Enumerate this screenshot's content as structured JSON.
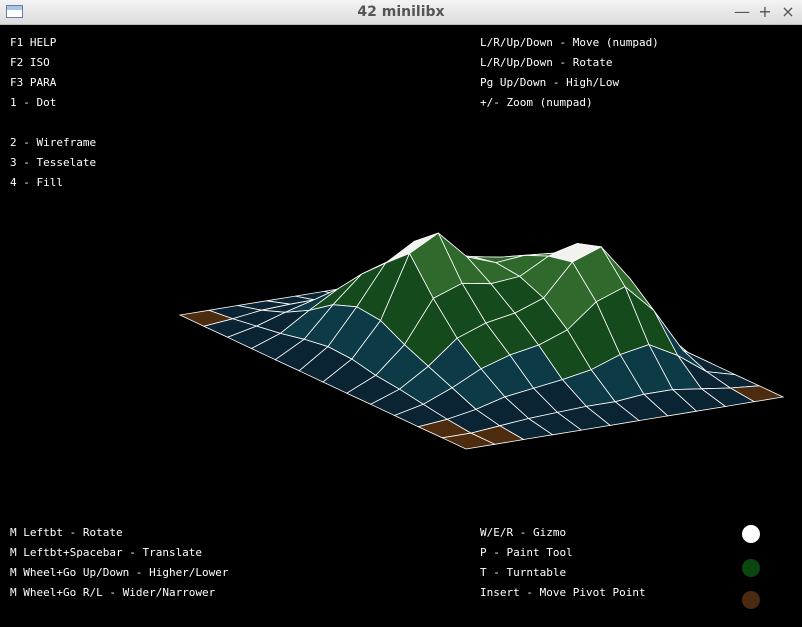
{
  "window": {
    "title": "42 minilibx",
    "minimize": "—",
    "maximize": "+",
    "close": "×"
  },
  "help_left": [
    "F1 HELP",
    "F2 ISO",
    "F3 PARA",
    "1 - Dot",
    "2 - Wireframe",
    "3 - Tesselate",
    "4 - Fill"
  ],
  "help_right": [
    "L/R/Up/Down - Move (numpad)",
    "L/R/Up/Down - Rotate",
    "Pg Up/Down - High/Low",
    "+/- Zoom (numpad)"
  ],
  "mouse_help": [
    "M Leftbt - Rotate",
    "M Leftbt+Spacebar - Translate",
    "M Wheel+Go Up/Down - Higher/Lower",
    "M Wheel+Go R/L - Wider/Narrower"
  ],
  "tool_help": [
    "W/E/R - Gizmo",
    "P - Paint Tool",
    "T - Turntable",
    "Insert - Move Pivot Point"
  ],
  "palette": {
    "swatches": [
      "#ffffff",
      "#0b4510",
      "#4a2a10"
    ]
  },
  "terrain": {
    "colors": {
      "peak": "#f2f2ee",
      "high": "#2f6a2c",
      "mid": "#154a1c",
      "low": "#0c3a46",
      "shore": "#0a2433",
      "ground": "#4c2b0e",
      "wire": "#ffffff"
    }
  }
}
